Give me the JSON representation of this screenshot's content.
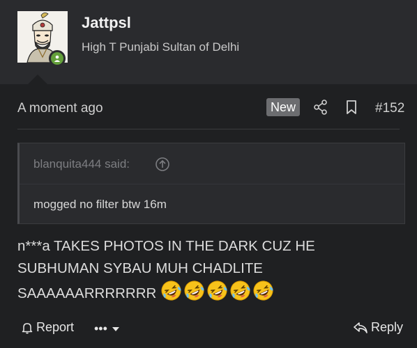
{
  "user": {
    "name": "Jattpsl",
    "title": "High T Punjabi Sultan of Delhi",
    "online": true
  },
  "meta": {
    "time": "A moment ago",
    "badge": "New",
    "post_number": "#152"
  },
  "quote": {
    "author": "blanquita444 said:",
    "text": "mogged no filter btw 16m"
  },
  "message": {
    "line1": "n***a TAKES PHOTOS IN THE DARK CUZ HE",
    "line2": "SUBHUMAN SYBAU MUH CHADLITE",
    "line3": "SAAAAAARRRRRRR",
    "emoji_count": 5
  },
  "footer": {
    "report_label": "Report",
    "more_label": "•••",
    "reply_label": "Reply"
  },
  "colors": {
    "background": "#1f2022",
    "header": "#2a2b2e",
    "online": "#63a03a",
    "badge": "#6c6d70"
  }
}
